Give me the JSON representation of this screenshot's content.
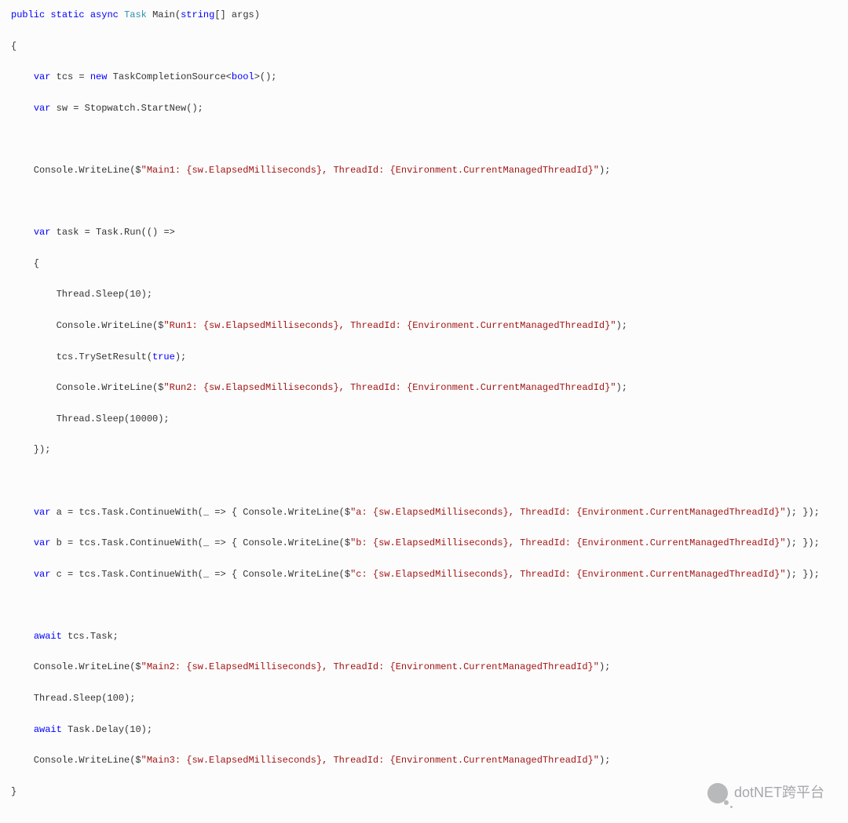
{
  "code": {
    "l1a": "public",
    "l1b": "static",
    "l1c": "async",
    "l1d": "Task",
    "l1e": " Main(",
    "l1f": "string",
    "l1g": "[] args)",
    "l2": "{",
    "l3a": "var",
    "l3b": " tcs = ",
    "l3c": "new",
    "l3d": " TaskCompletionSource<",
    "l3e": "bool",
    "l3f": ">();",
    "l4a": "var",
    "l4b": " sw = Stopwatch.StartNew();",
    "l6a": "    Console.WriteLine($",
    "l6b": "\"Main1: {sw.ElapsedMilliseconds}, ThreadId: {Environment.CurrentManagedThreadId}\"",
    "l6c": ");",
    "l8a": "var",
    "l8b": " task = Task.Run(() =>",
    "l9": "    {",
    "l10": "        Thread.Sleep(10);",
    "l11a": "        Console.WriteLine($",
    "l11b": "\"Run1: {sw.ElapsedMilliseconds}, ThreadId: {Environment.CurrentManagedThreadId}\"",
    "l11c": ");",
    "l12a": "        tcs.TrySetResult(",
    "l12b": "true",
    "l12c": ");",
    "l13a": "        Console.WriteLine($",
    "l13b": "\"Run2: {sw.ElapsedMilliseconds}, ThreadId: {Environment.CurrentManagedThreadId}\"",
    "l13c": ");",
    "l14": "        Thread.Sleep(10000);",
    "l15": "    });",
    "l17a": "var",
    "l17b": " a = tcs.Task.ContinueWith(_ => { Console.WriteLine($",
    "l17c": "\"a: {sw.ElapsedMilliseconds}, ThreadId: {Environment.CurrentManagedThreadId}\"",
    "l17d": "); });",
    "l18a": "var",
    "l18b": " b = tcs.Task.ContinueWith(_ => { Console.WriteLine($",
    "l18c": "\"b: {sw.ElapsedMilliseconds}, ThreadId: {Environment.CurrentManagedThreadId}\"",
    "l18d": "); });",
    "l19a": "var",
    "l19b": " c = tcs.Task.ContinueWith(_ => { Console.WriteLine($",
    "l19c": "\"c: {sw.ElapsedMilliseconds}, ThreadId: {Environment.CurrentManagedThreadId}\"",
    "l19d": "); });",
    "l21a": "await",
    "l21b": " tcs.Task;",
    "l22a": "    Console.WriteLine($",
    "l22b": "\"Main2: {sw.ElapsedMilliseconds}, ThreadId: {Environment.CurrentManagedThreadId}\"",
    "l22c": ");",
    "l23": "    Thread.Sleep(100);",
    "l24a": "await",
    "l24b": " Task.Delay(10);",
    "l25a": "    Console.WriteLine($",
    "l25b": "\"Main3: {sw.ElapsedMilliseconds}, ThreadId: {Environment.CurrentManagedThreadId}\"",
    "l25c": ");",
    "l26": "}"
  },
  "watermark": "dotNET跨平台"
}
